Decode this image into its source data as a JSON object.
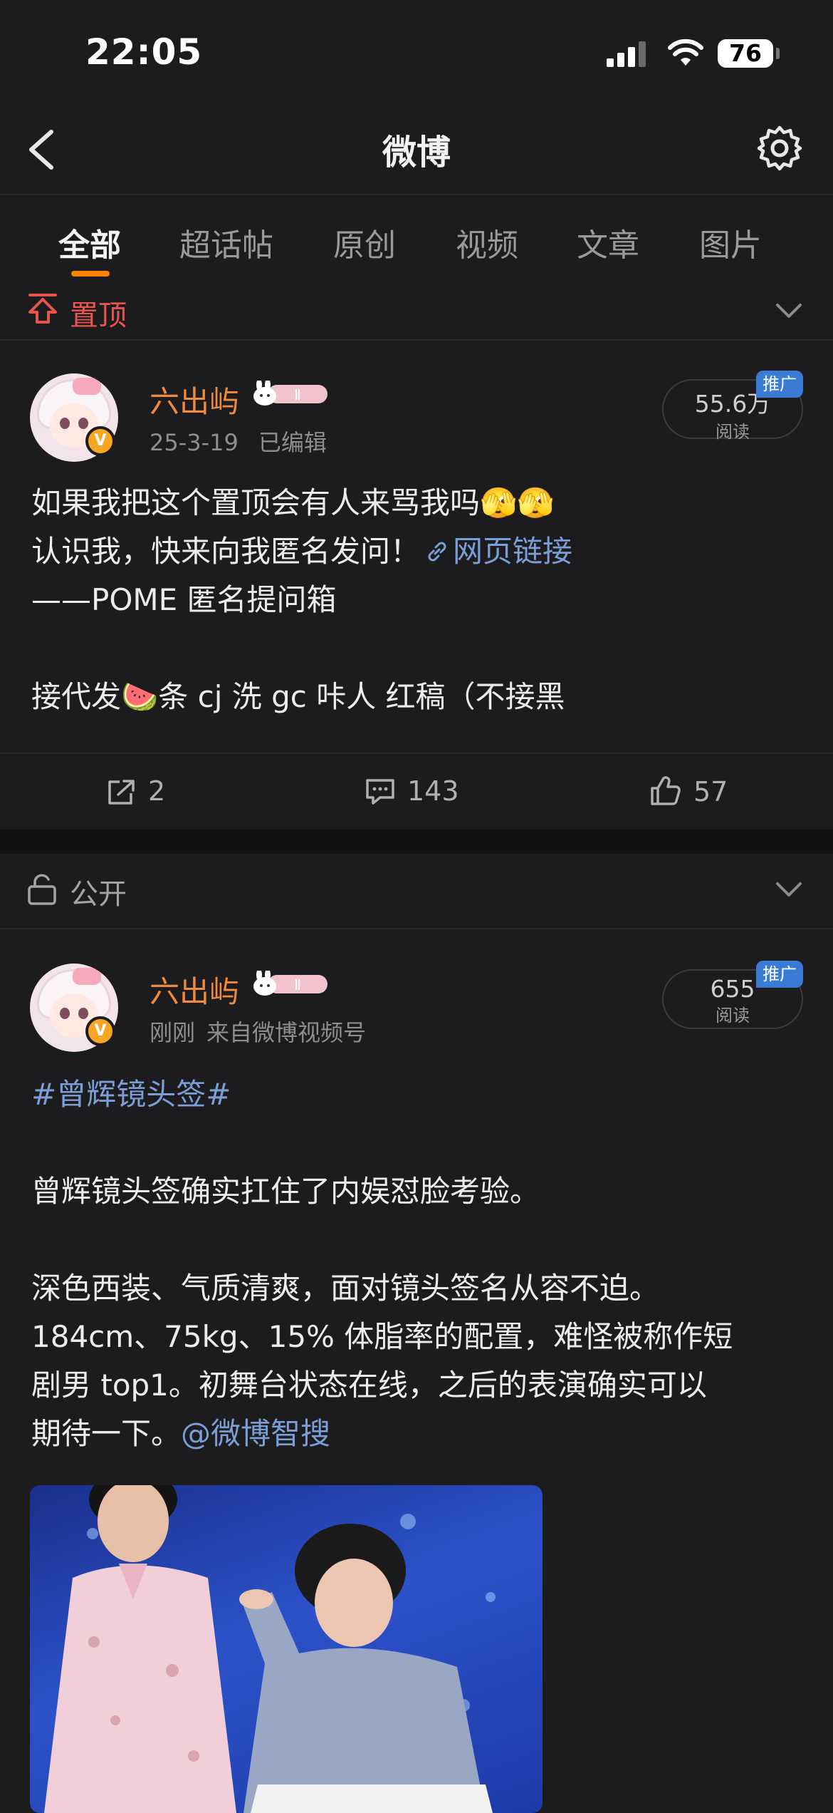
{
  "status": {
    "time": "22:05",
    "battery": "76"
  },
  "nav": {
    "title": "微博"
  },
  "tabs": [
    {
      "label": "全部"
    },
    {
      "label": "超话帖"
    },
    {
      "label": "原创"
    },
    {
      "label": "视频"
    },
    {
      "label": "文章"
    },
    {
      "label": "图片"
    }
  ],
  "active_tab": "全部",
  "pinned_section": {
    "label": "置顶"
  },
  "public_section": {
    "label": "公开"
  },
  "post1": {
    "username": "六出屿",
    "date": "25-3-19",
    "edited": "已编辑",
    "reads": "55.6万",
    "reads_label": "阅读",
    "promo": "推广",
    "line1": "如果我把这个置顶会有人来骂我吗🫣🫣",
    "line2_prefix": "认识我，快来向我匿名发问！",
    "line2_link": "网页链接",
    "line3": "——POME 匿名提问箱",
    "line4": "接代发🍉条 cj 洗 gc 咔人 红稿（不接黑",
    "reposts": "2",
    "comments": "143",
    "likes": "57"
  },
  "post2": {
    "username": "六出屿",
    "time": "刚刚",
    "source": "来自微博视频号",
    "reads": "655",
    "reads_label": "阅读",
    "promo": "推广",
    "hashtag": "#曾辉镜头签#",
    "para1": "曾辉镜头签确实扛住了内娱怼脸考验。",
    "para2_l1": "深色西装、气质清爽，面对镜头签名从容不迫。",
    "para2_l2": "184cm、75kg、15% 体脂率的配置，难怪被称作短",
    "para2_l3": "剧男 top1。初舞台状态在线，之后的表演确实可以",
    "para2_l4_prefix": "期待一下。",
    "para2_mention": "@微博智搜"
  },
  "colors": {
    "accent": "#ff8200",
    "username": "#f08a3c",
    "link": "#7b9ed6",
    "pinned": "#e8564b",
    "promo": "#3a7bd5"
  },
  "icons": [
    "back-icon",
    "gear-icon",
    "pin-icon",
    "lock-open-icon",
    "chevron-down-icon",
    "repost-icon",
    "comment-icon",
    "like-icon",
    "link-icon",
    "verified-icon"
  ]
}
